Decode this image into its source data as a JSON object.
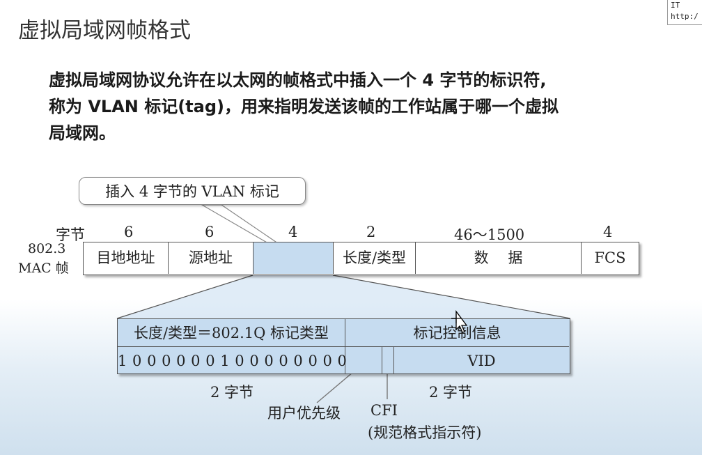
{
  "corner": {
    "line1": "IT",
    "line2": "http:/"
  },
  "title": "虚拟局域网帧格式",
  "intro": {
    "line1": "虚拟局域网协议允许在以太网的帧格式中插入一个 4 字节的标识符,",
    "line2": "称为 VLAN 标记(tag)，用来指明发送该帧的工作站属于哪一个虚拟",
    "line3": "局域网。"
  },
  "callout": "插入 4 字节的 VLAN 标记",
  "frame": {
    "bytes_label": "字节",
    "row_label_1": "802.3",
    "row_label_2": "MAC 帧",
    "fields": [
      {
        "name": "目地地址",
        "bytes": "6"
      },
      {
        "name": "源地址",
        "bytes": "6"
      },
      {
        "name": "",
        "bytes": "4"
      },
      {
        "name": "长度/类型",
        "bytes": "2"
      },
      {
        "name": "数　 据",
        "bytes": "46～1500"
      },
      {
        "name": "FCS",
        "bytes": "4"
      }
    ]
  },
  "tag_detail": {
    "header_left": "长度/类型＝802.1Q 标记类型",
    "header_right": "标记控制信息",
    "bits_value": "1 0 0 0 0 0 0 1  0 0 0 0 0 0 0 0",
    "vid": "VID",
    "left_size": "2 字节",
    "right_size": "2 字节",
    "priority_label": "用户优先级",
    "cfi_label": "CFI",
    "cfi_desc": "(规范格式指示符)"
  }
}
